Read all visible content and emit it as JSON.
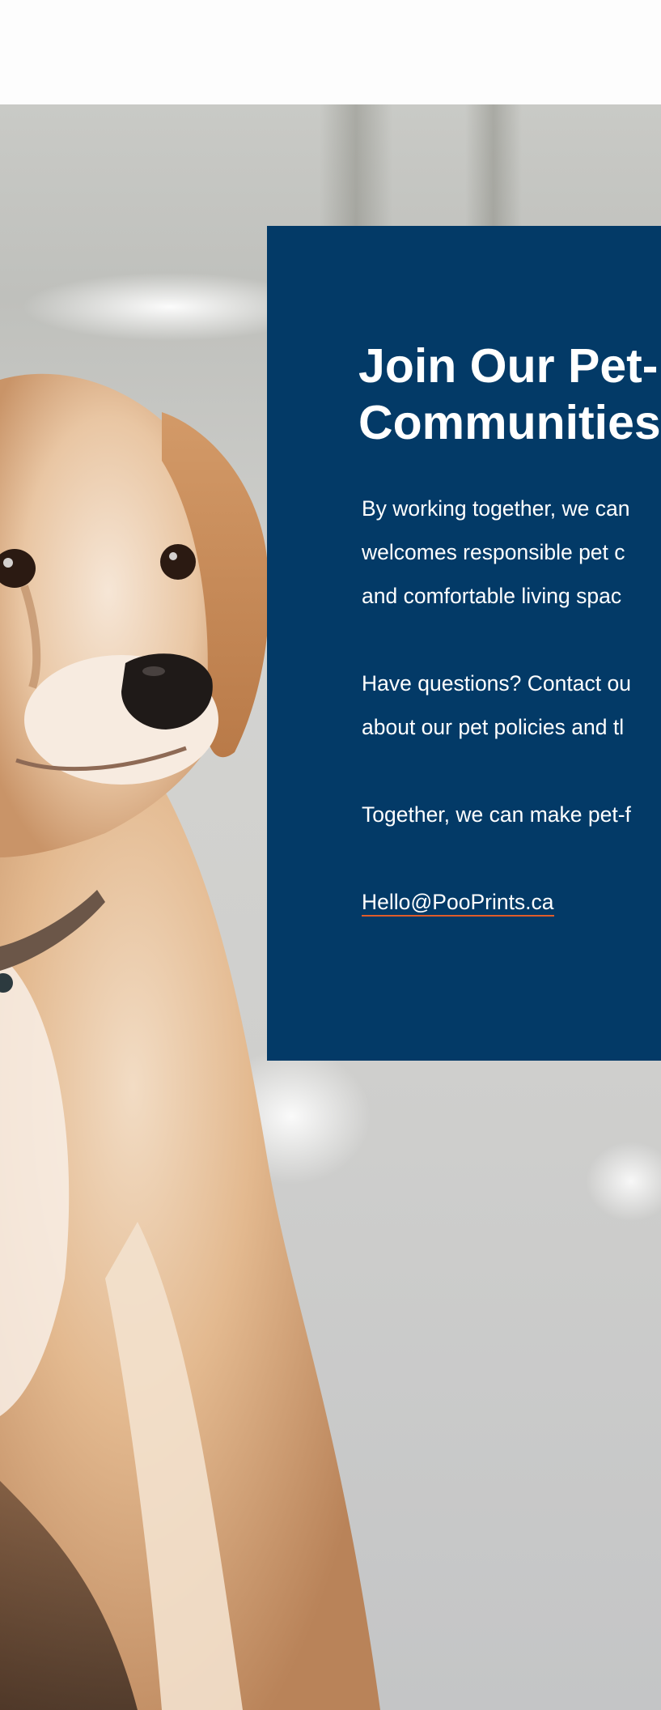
{
  "contact_panel": {
    "title_lines": [
      "Join Our Pet-",
      "Communities"
    ],
    "paragraph_1_lines": [
      "By working together, we can",
      "welcomes responsible pet c",
      "and comfortable living spac"
    ],
    "paragraph_2_lines": [
      "Have questions? Contact ou",
      "about our pet policies and tl"
    ],
    "paragraph_3": "Together, we can make pet-f",
    "email": "Hello@PooPrints.ca",
    "background_color": "#033a67",
    "link_underline_color": "#e05c2a"
  },
  "hero_image": {
    "icon": "dog-photo"
  }
}
